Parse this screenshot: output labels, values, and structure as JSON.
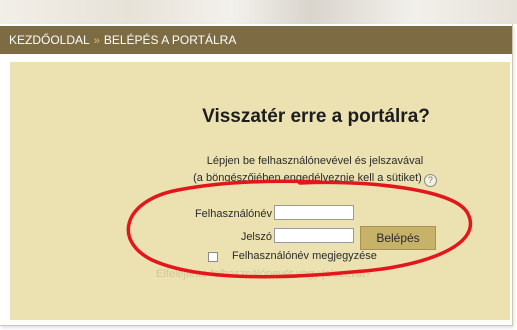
{
  "breadcrumb": {
    "home": "KEZDŐOLDAL",
    "separator": "»",
    "current": "BELÉPÉS A PORTÁLRA"
  },
  "login": {
    "heading": "Visszatér erre a portálra?",
    "desc_line1": "Lépjen be felhasználónevével és jelszavával",
    "desc_line2": "(a böngészőjében engedélyeznie kell a sütiket)",
    "help_icon": "?",
    "username_label": "Felhasználónév",
    "username_value": "",
    "password_label": "Jelszó",
    "password_value": "",
    "login_button": "Belépés",
    "remember_label": "Felhasználónév megjegyzése",
    "remember_checked": false,
    "forgot_link": "Elfelejtette felhasználónevét vagy jelszavát?"
  },
  "colors": {
    "breadcrumb_bg": "#7c6b43",
    "content_bg": "#ece2b1",
    "button_bg": "#c7b26a",
    "annotation_red": "#e3161b"
  },
  "icons": {
    "help": "help-icon",
    "annotation": "red-ellipse-annotation"
  }
}
